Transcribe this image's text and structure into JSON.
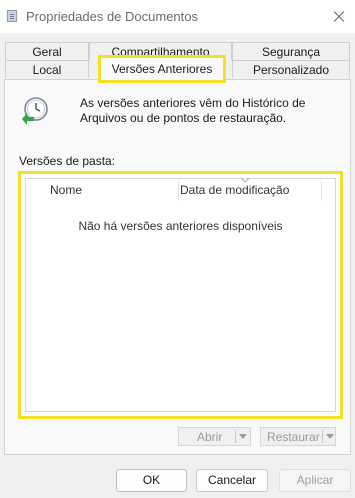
{
  "window": {
    "title": "Propriedades de Documentos"
  },
  "tabs": {
    "row_back": [
      "Geral",
      "Compartilhamento",
      "Segurança"
    ],
    "row_front": [
      "Local",
      "Versões Anteriores",
      "Personalizado"
    ],
    "active": "Versões Anteriores"
  },
  "info": {
    "text": "As versões anteriores vêm do Histórico de Arquivos ou de pontos de restauração."
  },
  "folder_versions": {
    "label": "Versões de pasta:",
    "columns": [
      "Nome",
      "Data de modificação"
    ],
    "empty_message": "Não há versões anteriores disponíveis"
  },
  "actions": {
    "open_label": "Abrir",
    "restore_label": "Restaurar"
  },
  "footer": {
    "ok_label": "OK",
    "cancel_label": "Cancelar",
    "apply_label": "Aplicar"
  },
  "colors": {
    "highlight": "#f4e024",
    "clock_green": "#33a64a"
  }
}
